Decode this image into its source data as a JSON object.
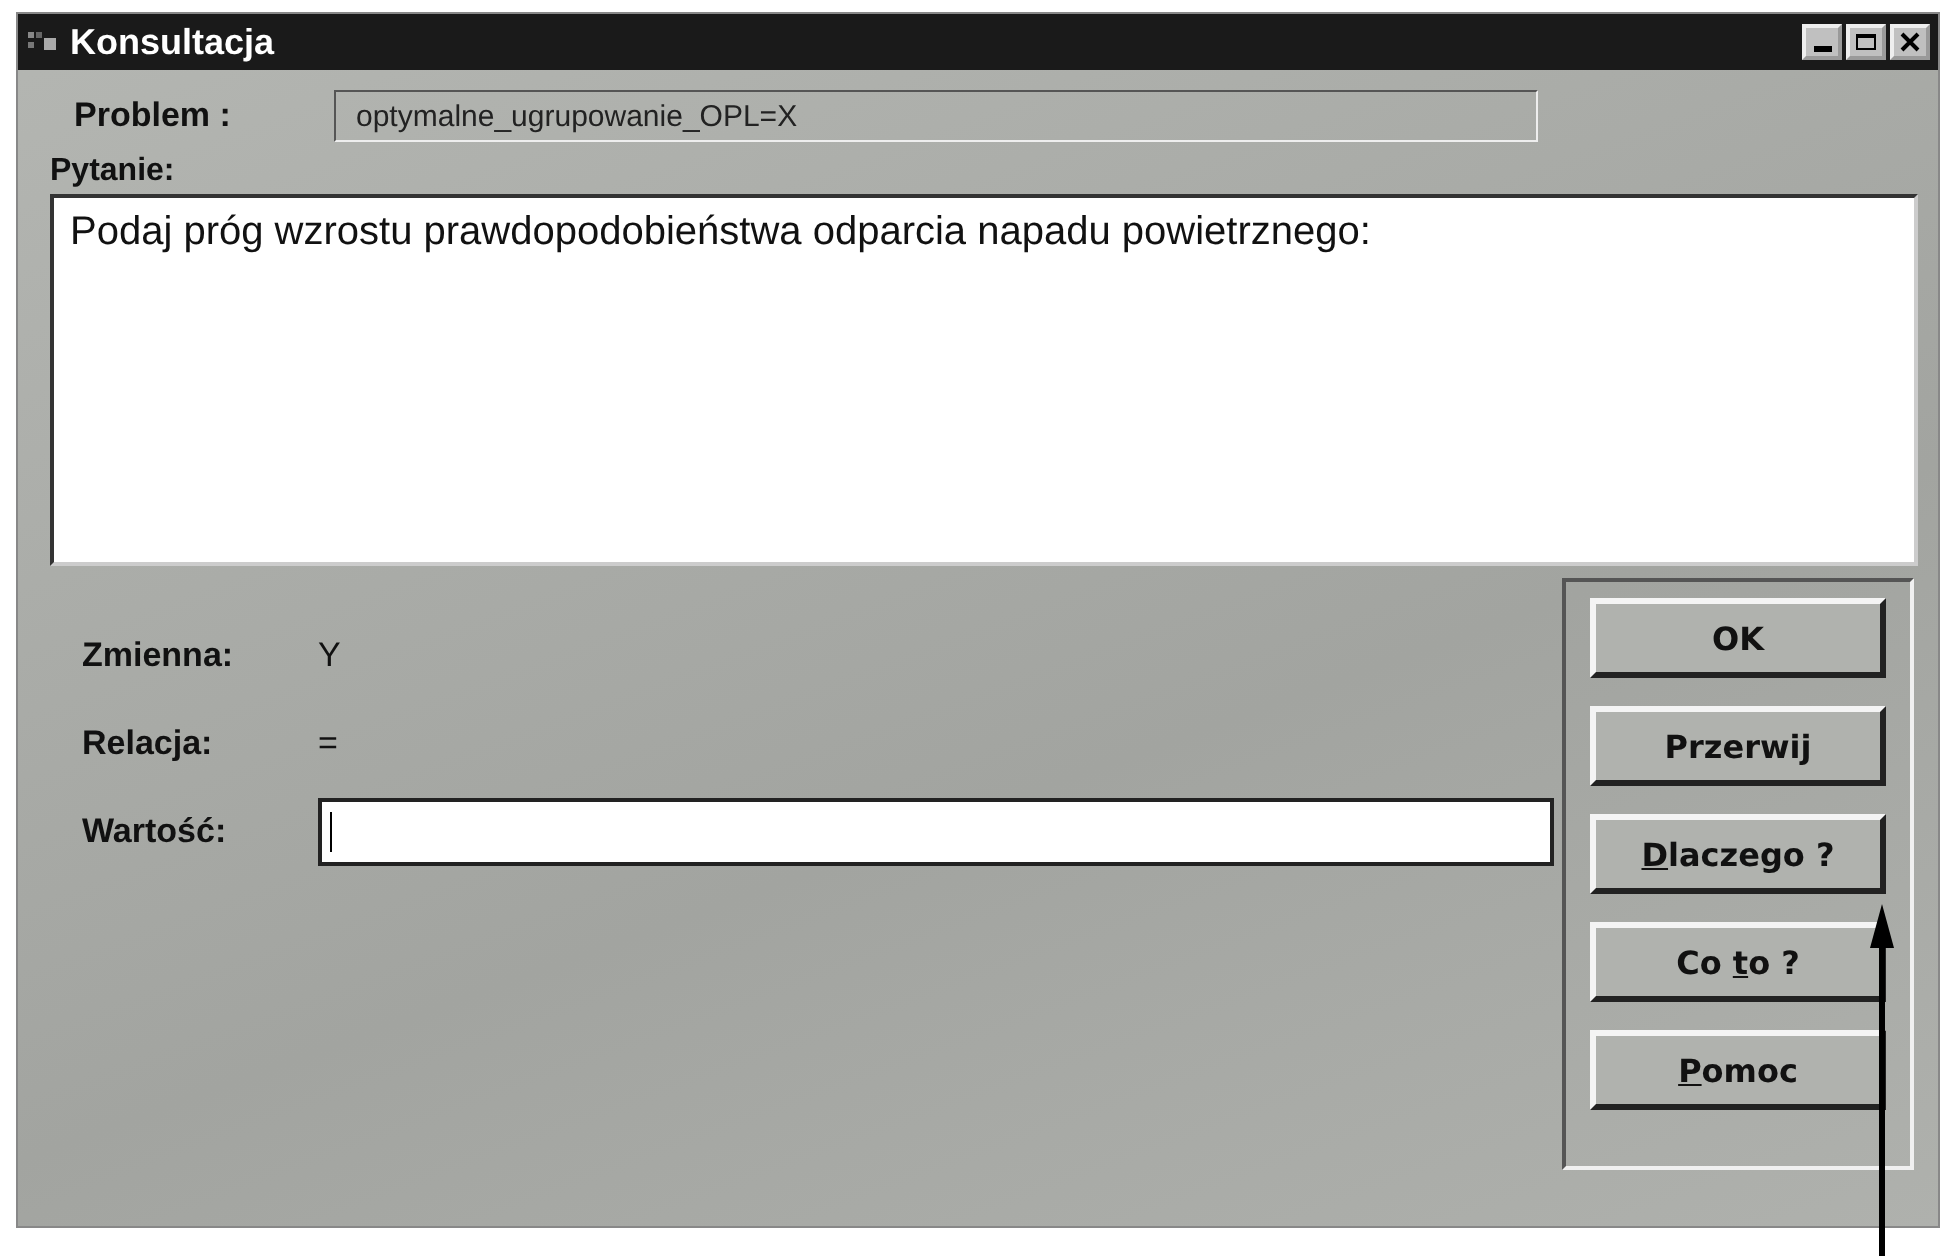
{
  "window": {
    "title": "Konsultacja",
    "controls": [
      {
        "kind": "minimize"
      },
      {
        "kind": "maximize"
      },
      {
        "kind": "close"
      }
    ]
  },
  "problem": {
    "label": "Problem :",
    "value": "optymalne_ugrupowanie_OPL=X"
  },
  "question": {
    "label": "Pytanie:",
    "text": "Podaj próg wzrostu prawdopodobieństwa odparcia napadu powietrznego:"
  },
  "fields": [
    {
      "kind": "text",
      "label": "Zmienna:",
      "value": "Y"
    },
    {
      "kind": "text",
      "label": "Relacja:",
      "value": "="
    },
    {
      "kind": "input",
      "label": "Wartość:"
    }
  ],
  "buttons": [
    {
      "parts": [
        {
          "text": "OK",
          "underline": false
        }
      ]
    },
    {
      "parts": [
        {
          "text": "Przerwij",
          "underline": false
        }
      ]
    },
    {
      "parts": [
        {
          "text": "D",
          "underline": true
        },
        {
          "text": "laczego ?",
          "underline": false
        }
      ]
    },
    {
      "parts": [
        {
          "text": "Co ",
          "underline": false
        },
        {
          "text": "t",
          "underline": true
        },
        {
          "text": "o ?",
          "underline": false
        }
      ]
    },
    {
      "parts": [
        {
          "text": "P",
          "underline": true
        },
        {
          "text": "omoc",
          "underline": false
        }
      ]
    }
  ]
}
